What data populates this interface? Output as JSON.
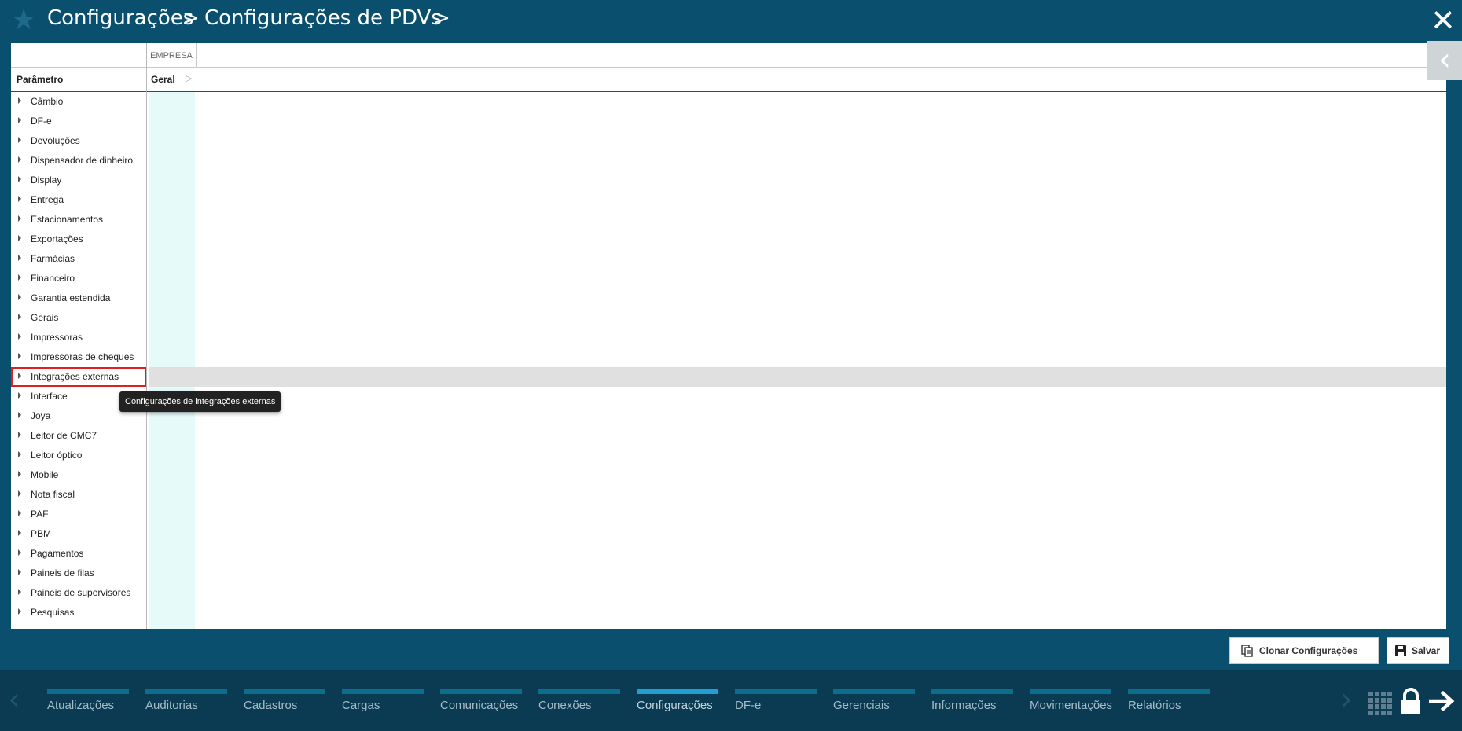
{
  "header": {
    "breadcrumb_1": "Configurações",
    "separator": ">",
    "breadcrumb_2": "Configurações de PDVs",
    "close_symbol": "✕"
  },
  "table": {
    "empresa_label": "EMPRESA",
    "param_header": "Parâmetro",
    "group_header": "Geral"
  },
  "tree": [
    "Câmbio",
    "DF-e",
    "Devoluções",
    "Dispensador de dinheiro",
    "Display",
    "Entrega",
    "Estacionamentos",
    "Exportações",
    "Farmácias",
    "Financeiro",
    "Garantia estendida",
    "Gerais",
    "Impressoras",
    "Impressoras de cheques",
    "Integrações externas",
    "Interface",
    "Joya",
    "Leitor de CMC7",
    "Leitor óptico",
    "Mobile",
    "Nota fiscal",
    "PAF",
    "PBM",
    "Pagamentos",
    "Paineis de filas",
    "Paineis de supervisores",
    "Pesquisas"
  ],
  "tooltip": "Configurações de integrações externas",
  "actions": {
    "clone": "Clonar Configurações",
    "save": "Salvar"
  },
  "footer_tabs": [
    "Atualizações",
    "Auditorias",
    "Cadastros",
    "Cargas",
    "Comunicações",
    "Conexões",
    "Configurações",
    "DF-e",
    "Gerenciais",
    "Informações",
    "Movimentações",
    "Relatórios"
  ],
  "active_tab": "Configurações",
  "colors": {
    "background": "#0a506e",
    "footer": "#0b3a53",
    "accent": "#1f9fd2",
    "selection_outline": "#e02020"
  }
}
